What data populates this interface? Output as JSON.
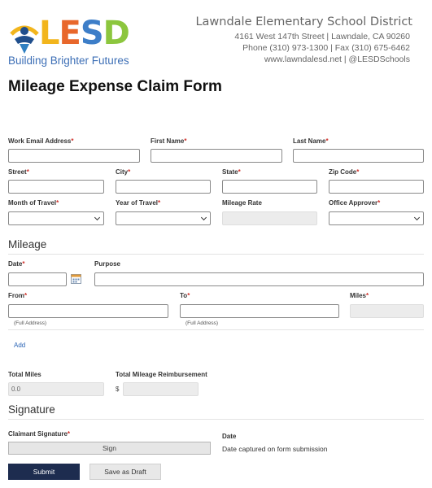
{
  "header": {
    "logo_text": "LESD",
    "tagline": "Building Brighter Futures",
    "district": "Lawndale Elementary School District",
    "address": "4161 West 147th Street | Lawndale, CA 90260",
    "phone": "Phone (310) 973-1300 | Fax (310) 675-6462",
    "web": "www.lawndalesd.net | @LESDSchools"
  },
  "form_title": "Mileage Expense Claim Form",
  "required_marker": "*",
  "fields": {
    "work_email": "Work Email Address",
    "first_name": "First Name",
    "last_name": "Last Name",
    "street": "Street",
    "city": "City",
    "state": "State",
    "zip": "Zip Code",
    "month": "Month of Travel",
    "year": "Year of Travel",
    "mileage_rate": "Mileage Rate",
    "approver": "Office Approver"
  },
  "mileage": {
    "heading": "Mileage",
    "date": "Date",
    "purpose": "Purpose",
    "from": "From",
    "to": "To",
    "miles": "Miles",
    "from_hint": "(Full Address)",
    "to_hint": "(Full Address)",
    "add_link": "Add"
  },
  "totals": {
    "total_miles_label": "Total Miles",
    "total_miles_value": "0.0",
    "reimbursement_label": "Total Mileage Reimbursement",
    "currency": "$"
  },
  "signature": {
    "heading": "Signature",
    "claimant_label": "Claimant Signature",
    "sign_button": "Sign",
    "date_label": "Date",
    "date_note": "Date captured on form submission"
  },
  "actions": {
    "submit": "Submit",
    "save_draft": "Save as Draft"
  },
  "colors": {
    "logo_l": "#f2b51c",
    "logo_e": "#e8672b",
    "logo_s": "#3d7ec8",
    "logo_d": "#8cc63e",
    "submit_bg": "#1d2c4f",
    "required": "#d0302a"
  }
}
